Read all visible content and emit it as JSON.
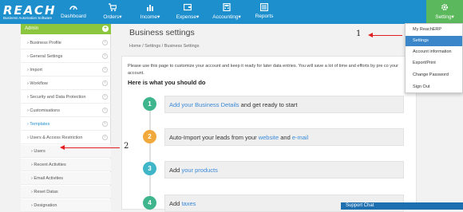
{
  "brand": {
    "name": "REACH",
    "tagline": "Business Automation Software"
  },
  "nav": [
    {
      "label": "Dashboard",
      "icon": "dashboard-icon"
    },
    {
      "label": "Orders",
      "icon": "cart-icon"
    },
    {
      "label": "Income",
      "icon": "bar-chart-icon"
    },
    {
      "label": "Expense",
      "icon": "wallet-icon"
    },
    {
      "label": "Accounting",
      "icon": "calculator-icon"
    },
    {
      "label": "Reports",
      "icon": "report-icon"
    },
    {
      "label": "Setting",
      "icon": "gear-icon"
    }
  ],
  "sidebar": {
    "header": "Admin",
    "items": [
      {
        "label": "Business Profile"
      },
      {
        "label": "General Settings"
      },
      {
        "label": "Import"
      },
      {
        "label": "Workflow"
      },
      {
        "label": "Security and Data Protection"
      },
      {
        "label": "Customisations"
      },
      {
        "label": "Templates"
      },
      {
        "label": "Users & Access Restriction"
      },
      {
        "label": "Users"
      },
      {
        "label": "Recent Activities"
      },
      {
        "label": "Email Activities"
      },
      {
        "label": "Reset Datas"
      },
      {
        "label": "Designation"
      }
    ]
  },
  "main": {
    "title": "Business settings",
    "breadcrumb": {
      "home": "Home",
      "settings": "Settings",
      "current": "Business Settings",
      "separator": "/"
    },
    "intro": "Please use this page to customize your account and keep it ready for later data entries. You will save a lot of time and efforts by pre co your account.",
    "subhead": "Here is what you should do",
    "steps": [
      {
        "num": "1",
        "color": "#3fb58e",
        "pre": "",
        "link": "Add your Business Details",
        "post": " and get ready to start"
      },
      {
        "num": "2",
        "color": "#f2a93b",
        "pre": "Auto-Import your leads from your ",
        "link": "website",
        "mid": " and ",
        "link2": "e-mail",
        "post": ""
      },
      {
        "num": "3",
        "color": "#3fb6c8",
        "pre": "Add ",
        "link": "your products",
        "post": ""
      },
      {
        "num": "4",
        "color": "#3fb58e",
        "pre": "Add ",
        "link": "taxes",
        "post": ""
      }
    ]
  },
  "dropdown": {
    "items": [
      {
        "label": "My ReachERP"
      },
      {
        "label": "Settings"
      },
      {
        "label": "Account information"
      },
      {
        "label": "Export/Print"
      },
      {
        "label": "Change Password"
      },
      {
        "label": "Sign Out"
      }
    ]
  },
  "annotations": {
    "one": "1",
    "two": "2"
  },
  "support_chat": "Support Chat",
  "colors": {
    "topbar": "#1e8fcd",
    "active_nav": "#5cb85c",
    "sidebar_header": "#8cc63f",
    "link": "#3b8ad8",
    "annotation": "#e02020"
  }
}
